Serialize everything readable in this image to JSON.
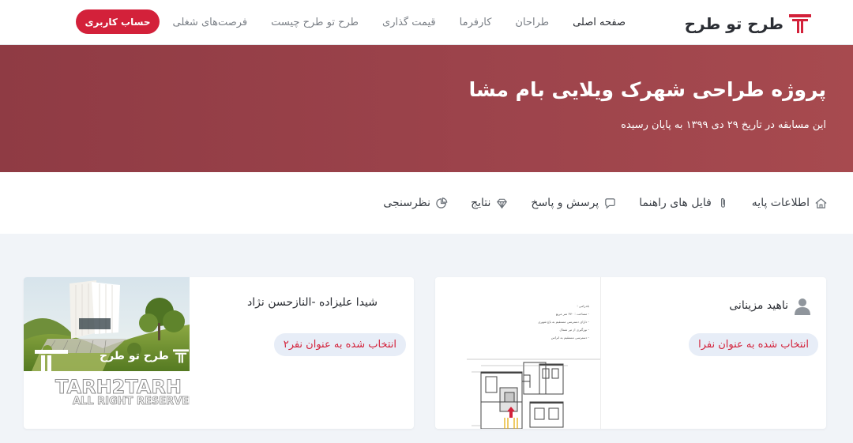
{
  "brand": {
    "name": "طرح تو طرح",
    "accent": "#d3213a"
  },
  "nav": {
    "items": [
      {
        "label": "صفحه اصلی",
        "active": true
      },
      {
        "label": "طراحان",
        "active": false
      },
      {
        "label": "کارفرما",
        "active": false
      },
      {
        "label": "قیمت گذاری",
        "active": false
      },
      {
        "label": "طرح تو طرح چیست",
        "active": false
      },
      {
        "label": "فرصت‌های شغلی",
        "active": false
      }
    ],
    "account_label": "حساب کاربری"
  },
  "hero": {
    "title": "پروژه طراحی شهرک ویلایی بام مشا",
    "subtitle": "این مسابقه در تاریخ ۲۹ دی ۱۳۹۹ به پایان رسیده",
    "background": "#9c434b"
  },
  "tabs": [
    {
      "label": "اطلاعات پایه",
      "icon": "home-icon"
    },
    {
      "label": "فایل های راهنما",
      "icon": "paperclip-icon"
    },
    {
      "label": "پرسش و پاسخ",
      "icon": "chat-bubble-icon"
    },
    {
      "label": "نتایج",
      "icon": "diamond-icon"
    },
    {
      "label": "نظرسنجی",
      "icon": "pie-chart-icon"
    }
  ],
  "entries": [
    {
      "designer": "ناهید مزینانی",
      "badge": "انتخاب شده به عنوان نفرا",
      "thumbnail": "floor-plan"
    },
    {
      "designer": "شیدا علیزاده -النازحسن نژاد",
      "badge": "انتخاب شده به عنوان نفر۲",
      "thumbnail": "villa-render",
      "watermark": {
        "brand": "طرح تو طرح",
        "latin": "TARH2TARH",
        "rights": "ALL RIGHT RESERVED",
        "symbol": "©"
      }
    }
  ],
  "plan_notes": [
    "بلدرامی :",
    "- مساحت : ۳۷۰ متر مربع",
    "- دارای دسترسی مستقیم به باغ شهری",
    "- نورگیری از تیر شمال",
    "- دسترسی مستقیم به اتراس"
  ]
}
